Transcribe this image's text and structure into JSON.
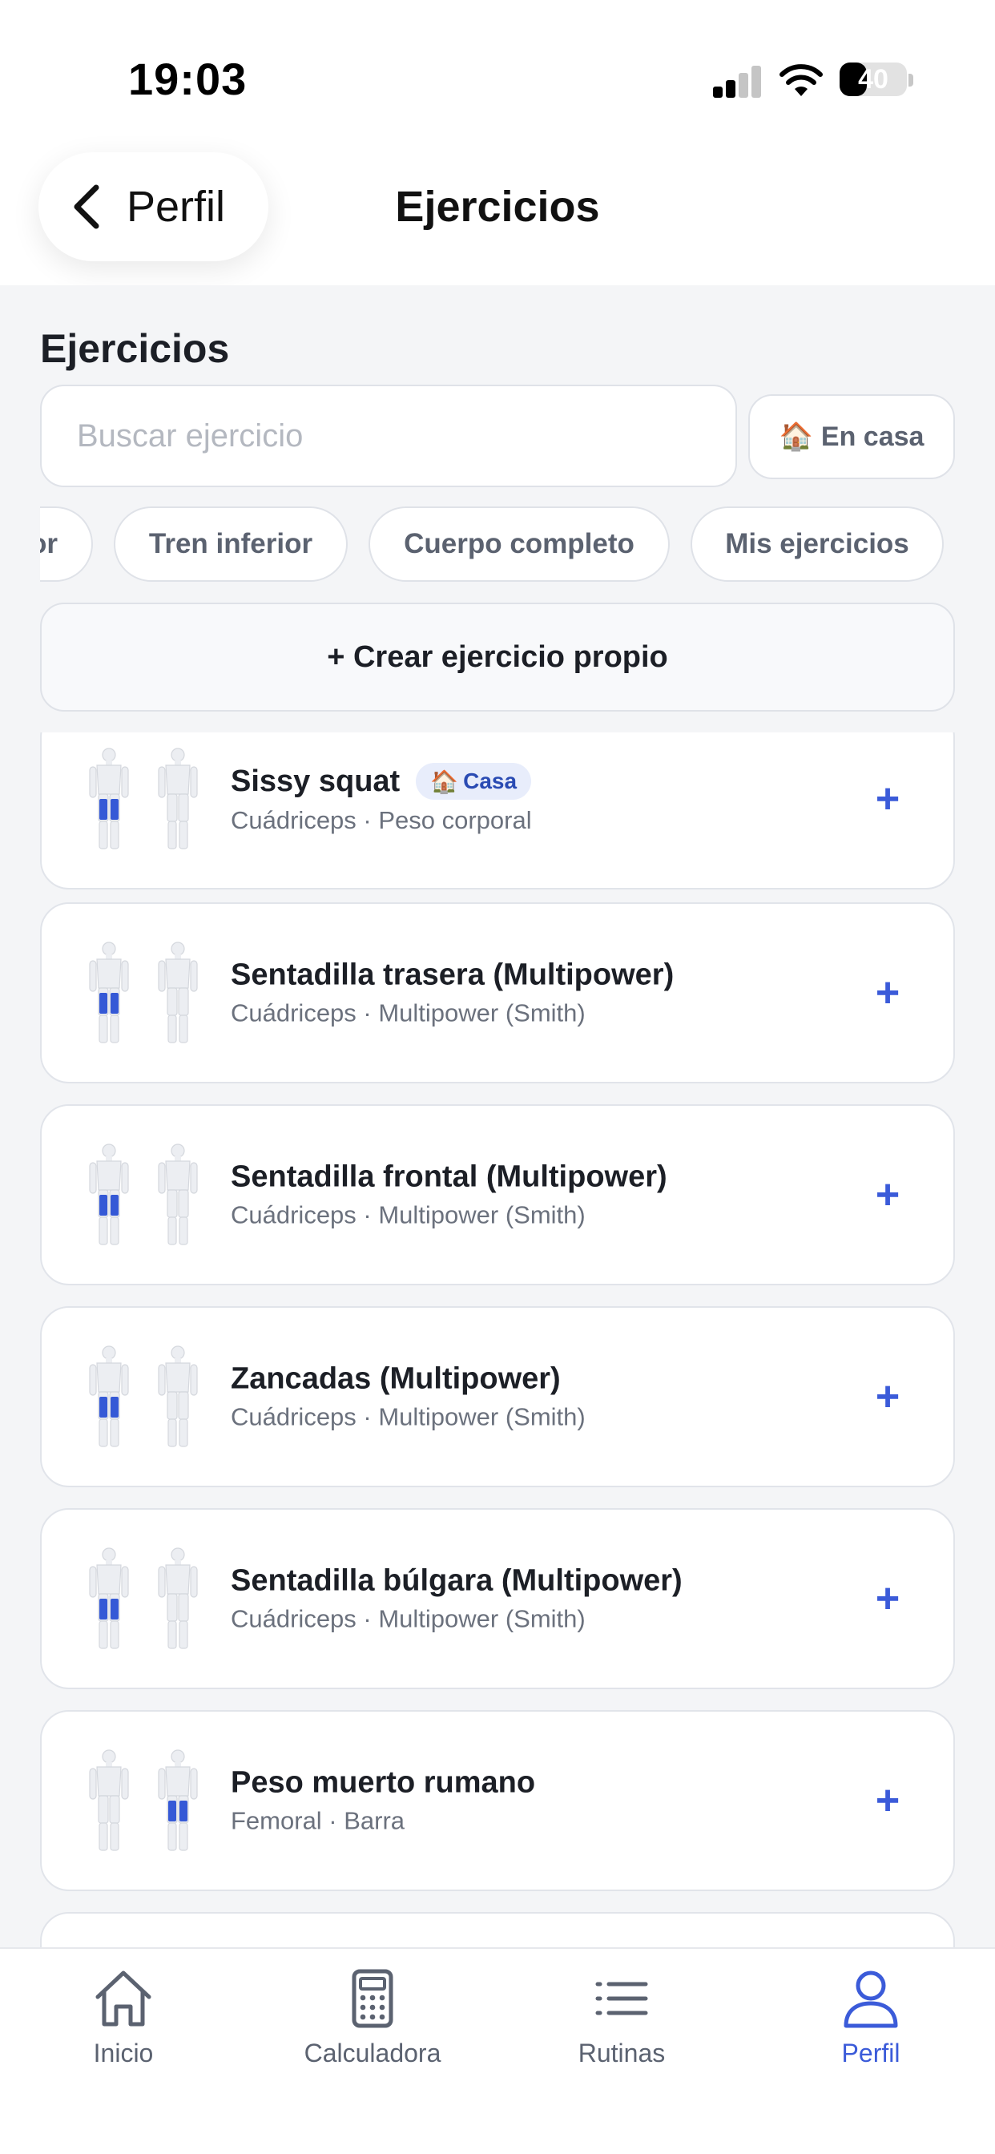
{
  "status_bar": {
    "time": "19:03",
    "battery_level": "40",
    "battery_fraction": 0.4,
    "signal_bars_active": 2,
    "signal_bars_total": 4
  },
  "header": {
    "back_label": "Perfil",
    "title": "Ejercicios"
  },
  "page": {
    "section_title": "Ejercicios",
    "search_placeholder": "Buscar ejercicio",
    "home_filter": {
      "emoji": "🏠",
      "label": "En casa"
    },
    "chips": [
      "Tren superior",
      "Tren inferior",
      "Cuerpo completo",
      "Mis ejercicios"
    ],
    "create_button": "+ Crear ejercicio propio"
  },
  "exercises": [
    {
      "name": "Sissy squat",
      "muscle": "Cuádriceps",
      "equipment": "Peso corporal",
      "sub": "Cuádriceps · Peso corporal",
      "badge": {
        "emoji": "🏠",
        "label": "Casa"
      },
      "highlight": "front-legs"
    },
    {
      "name": "Sentadilla trasera (Multipower)",
      "muscle": "Cuádriceps",
      "equipment": "Multipower (Smith)",
      "sub": "Cuádriceps · Multipower (Smith)",
      "badge": null,
      "highlight": "front-legs"
    },
    {
      "name": "Sentadilla frontal (Multipower)",
      "muscle": "Cuádriceps",
      "equipment": "Multipower (Smith)",
      "sub": "Cuádriceps · Multipower (Smith)",
      "badge": null,
      "highlight": "front-legs"
    },
    {
      "name": "Zancadas (Multipower)",
      "muscle": "Cuádriceps",
      "equipment": "Multipower (Smith)",
      "sub": "Cuádriceps · Multipower (Smith)",
      "badge": null,
      "highlight": "front-legs"
    },
    {
      "name": "Sentadilla búlgara (Multipower)",
      "muscle": "Cuádriceps",
      "equipment": "Multipower (Smith)",
      "sub": "Cuádriceps · Multipower (Smith)",
      "badge": null,
      "highlight": "front-legs"
    },
    {
      "name": "Peso muerto rumano",
      "muscle": "Femoral",
      "equipment": "Barra",
      "sub": "Femoral · Barra",
      "badge": null,
      "highlight": "back-legs"
    },
    {
      "name": "",
      "sub": "",
      "badge": null,
      "highlight": "none"
    }
  ],
  "add_label": "+",
  "tab_bar": {
    "tabs": [
      {
        "label": "Inicio",
        "icon": "home-icon",
        "active": false
      },
      {
        "label": "Calculadora",
        "icon": "calculator-icon",
        "active": false
      },
      {
        "label": "Rutinas",
        "icon": "list-icon",
        "active": false
      },
      {
        "label": "Perfil",
        "icon": "user-icon",
        "active": true
      }
    ]
  },
  "colors": {
    "accent": "#3b5bd9",
    "muscle_highlight": "#3559d6",
    "page_background": "#f4f5f7",
    "muted_text": "#6b717d"
  }
}
